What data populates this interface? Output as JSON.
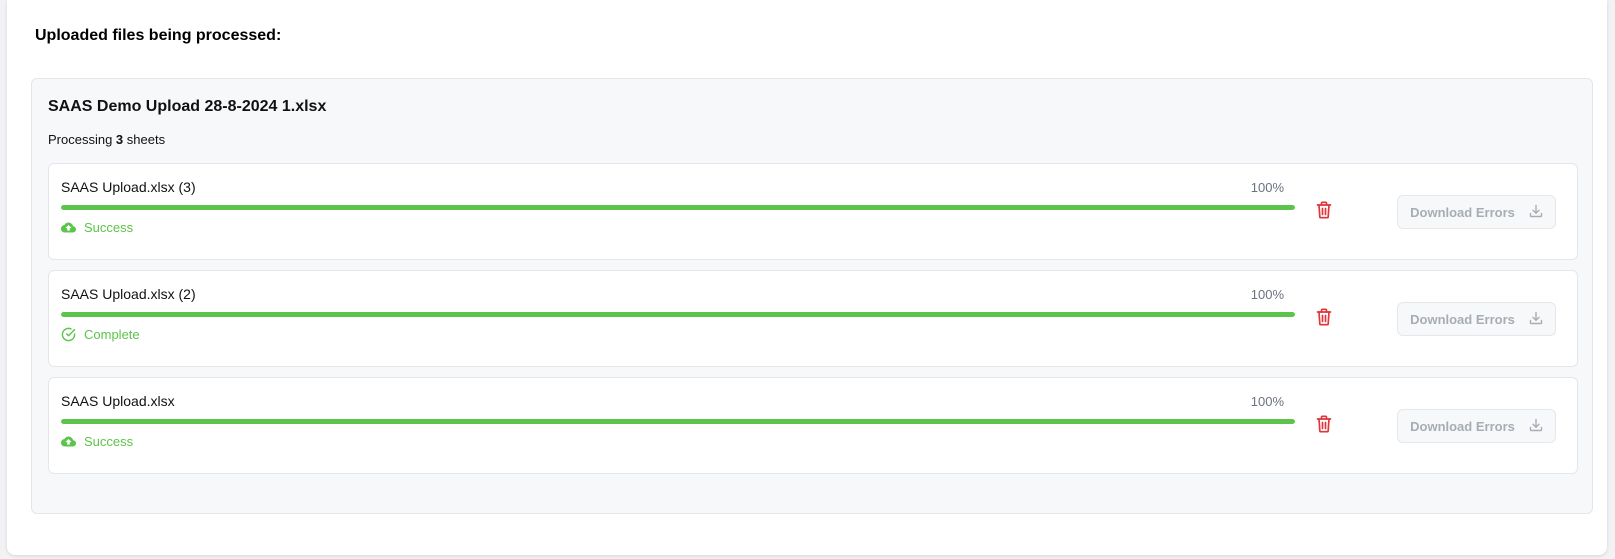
{
  "page": {
    "heading": "Uploaded files being processed:"
  },
  "upload": {
    "file_name": "SAAS Demo Upload 28-8-2024 1.xlsx",
    "processing_prefix": "Processing ",
    "sheet_count": "3",
    "processing_suffix": " sheets"
  },
  "sheets": [
    {
      "name": "SAAS Upload.xlsx (3)",
      "percent_label": "100%",
      "progress": 1.0,
      "status": "Success",
      "status_icon": "cloud-upload-icon",
      "download_label": "Download Errors"
    },
    {
      "name": "SAAS Upload.xlsx (2)",
      "percent_label": "100%",
      "progress": 1.0,
      "status": "Complete",
      "status_icon": "check-circle-icon",
      "download_label": "Download Errors"
    },
    {
      "name": "SAAS Upload.xlsx",
      "percent_label": "100%",
      "progress": 1.0,
      "status": "Success",
      "status_icon": "cloud-upload-icon",
      "download_label": "Download Errors"
    }
  ],
  "colors": {
    "success": "#5cc44a",
    "danger": "#e0353b",
    "disabled_text": "#a7adb5"
  }
}
